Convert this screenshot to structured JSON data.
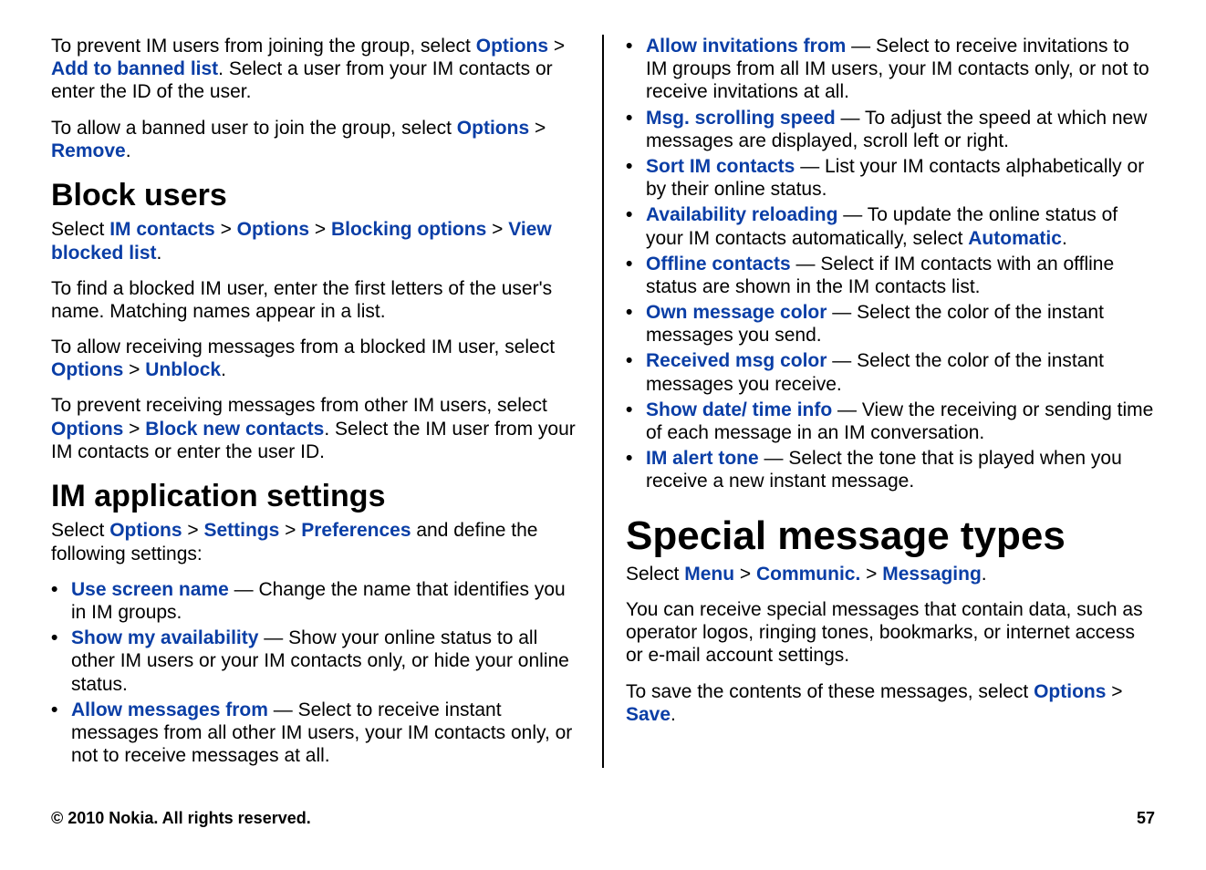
{
  "left": {
    "para1": {
      "t1": "To prevent IM users from joining the group, select ",
      "opt": "Options",
      "gt": " > ",
      "add": "Add to banned list",
      "rest": ". Select a user from your IM contacts or enter the ID of the user."
    },
    "para2": {
      "t1": "To allow a banned user to join the group, select ",
      "opt": "Options",
      "gt": " > ",
      "remove": "Remove",
      "rest": "."
    },
    "h_block": "Block users",
    "para3": {
      "select": "Select ",
      "imc": "IM contacts",
      "gt1": " > ",
      "opt": "Options",
      "gt2": " > ",
      "bopt": "Blocking options",
      "gt3": " > ",
      "view": "View blocked list",
      "rest": "."
    },
    "para4": "To find a blocked IM user, enter the first letters of the user's name. Matching names appear in a list.",
    "para5": {
      "t1": "To allow receiving messages from a blocked IM user, select ",
      "opt": "Options",
      "gt": " > ",
      "unblock": "Unblock",
      "rest": "."
    },
    "para6": {
      "t1": "To prevent receiving messages from other IM users, select ",
      "opt": "Options",
      "gt": " > ",
      "block": "Block new contacts",
      "rest": ". Select the IM user from your IM contacts or enter the user ID."
    },
    "h_im": "IM application settings",
    "para7": {
      "select": "Select ",
      "opt": "Options",
      "gt1": " > ",
      "settings": "Settings",
      "gt2": " > ",
      "prefs": "Preferences",
      "rest": " and define the following settings:"
    },
    "bullets": [
      {
        "term": "Use screen name",
        "desc": " — Change the name that identifies you in IM groups."
      },
      {
        "term": "Show my availability",
        "desc": " — Show your online status to all other IM users or your IM contacts only, or hide your online status."
      },
      {
        "term": "Allow messages from",
        "desc": " — Select to receive instant messages from all other IM users, your IM contacts only, or not to receive messages at all."
      }
    ]
  },
  "right": {
    "bullets": [
      {
        "term": "Allow invitations from",
        "desc": " — Select to receive invitations to IM groups from all IM users, your IM contacts only, or not to receive invitations at all."
      },
      {
        "term": "Msg. scrolling speed",
        "desc": " — To adjust the speed at which new messages are displayed, scroll left or right."
      },
      {
        "term": "Sort IM contacts",
        "desc": " — List your IM contacts alphabetically or by their online status."
      },
      {
        "term": "Availability reloading",
        "pre": " — To update the online status of your IM contacts automatically, select ",
        "extra": "Automatic",
        "post": "."
      },
      {
        "term": "Offline contacts",
        "desc": " — Select if IM contacts with an offline status are shown in the IM contacts list."
      },
      {
        "term": "Own message color",
        "desc": " — Select the color of the instant messages you send."
      },
      {
        "term": "Received msg color",
        "desc": " — Select the color of the instant messages you receive."
      },
      {
        "term": "Show date/ time info",
        "desc": " — View the receiving or sending time of each message in an IM conversation."
      },
      {
        "term": "IM alert tone",
        "desc": " — Select the tone that is played when you receive a new instant message."
      }
    ],
    "h_special": "Special message types",
    "para1": {
      "select": "Select ",
      "menu": "Menu",
      "gt1": " > ",
      "comm": "Communic.",
      "gt2": " > ",
      "msg": "Messaging",
      "rest": "."
    },
    "para2": "You can receive special messages that contain data, such as operator logos, ringing tones, bookmarks, or internet access or e-mail account settings.",
    "para3": {
      "t1": "To save the contents of these messages, select ",
      "opt": "Options",
      "gt": " > ",
      "save": "Save",
      "rest": "."
    }
  },
  "footer": {
    "copyright": "© 2010 Nokia. All rights reserved.",
    "page": "57"
  }
}
